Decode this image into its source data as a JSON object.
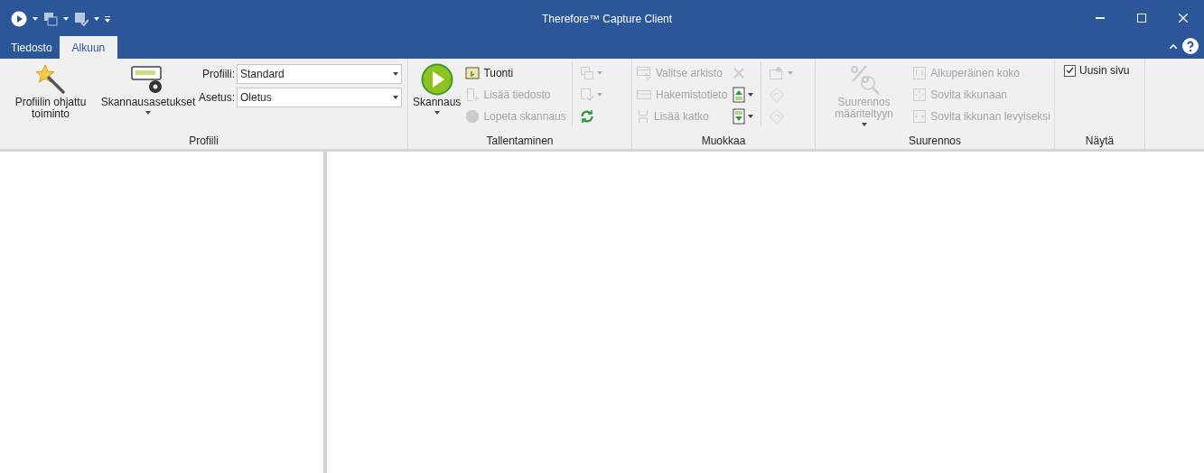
{
  "window": {
    "title": "Therefore™ Capture Client"
  },
  "tabs": [
    {
      "label": "Tiedosto",
      "selected": false
    },
    {
      "label": "Alkuun",
      "selected": true
    }
  ],
  "groups": [
    {
      "label": "Profiili",
      "columns": [
        {
          "kind": "large",
          "items": [
            {
              "label": "Profiilin ohjattu toiminto",
              "disabled": false,
              "dropdown": false
            }
          ]
        },
        {
          "kind": "large",
          "items": [
            {
              "label": "Skannausasetukset",
              "disabled": false,
              "dropdown": true
            }
          ]
        },
        {
          "kind": "combos",
          "items": [
            {
              "label": "Profiili:",
              "value": "Standard"
            },
            {
              "label": "Asetus:",
              "value": "Oletus"
            }
          ]
        }
      ]
    },
    {
      "label": "Tallentaminen",
      "columns": [
        {
          "kind": "large",
          "items": [
            {
              "label": "Skannaus",
              "disabled": false,
              "dropdown": true
            }
          ]
        },
        {
          "kind": "stack",
          "items": [
            {
              "label": "Tuonti",
              "disabled": false
            },
            {
              "label": "Lisää tiedosto",
              "disabled": true
            },
            {
              "label": "Lopeta skannaus",
              "disabled": true
            }
          ]
        },
        {
          "kind": "separator"
        },
        {
          "kind": "icons",
          "items": [
            {
              "disabled": true,
              "dropdown": true
            },
            {
              "disabled": true,
              "dropdown": true
            },
            {
              "disabled": false,
              "dropdown": false
            }
          ]
        }
      ]
    },
    {
      "label": "Muokkaa",
      "columns": [
        {
          "kind": "stack",
          "items": [
            {
              "label": "Valitse arkisto",
              "disabled": true
            },
            {
              "label": "Hakemistotieto",
              "disabled": true
            },
            {
              "label": "Lisää katko",
              "disabled": true
            }
          ]
        },
        {
          "kind": "icons",
          "items": [
            {
              "disabled": true,
              "dropdown": false
            },
            {
              "disabled": false,
              "dropdown": true
            },
            {
              "disabled": false,
              "dropdown": true
            }
          ]
        },
        {
          "kind": "separator"
        },
        {
          "kind": "icons",
          "items": [
            {
              "disabled": true,
              "dropdown": true
            },
            {
              "disabled": true,
              "dropdown": false
            },
            {
              "disabled": true,
              "dropdown": false
            }
          ]
        }
      ]
    },
    {
      "label": "Suurennos",
      "columns": [
        {
          "kind": "large",
          "items": [
            {
              "label": "Suurennos määriteltyyn",
              "disabled": true,
              "dropdown": true
            }
          ]
        },
        {
          "kind": "stack",
          "items": [
            {
              "label": "Alkuperäinen koko",
              "disabled": true
            },
            {
              "label": "Sovita ikkunaan",
              "disabled": true
            },
            {
              "label": "Sovita ikkunan levyiseksi",
              "disabled": true
            }
          ]
        }
      ]
    },
    {
      "label": "Näytä",
      "columns": [
        {
          "kind": "checks",
          "items": [
            {
              "label": "Uusin sivu",
              "checked": true
            }
          ]
        }
      ]
    }
  ]
}
